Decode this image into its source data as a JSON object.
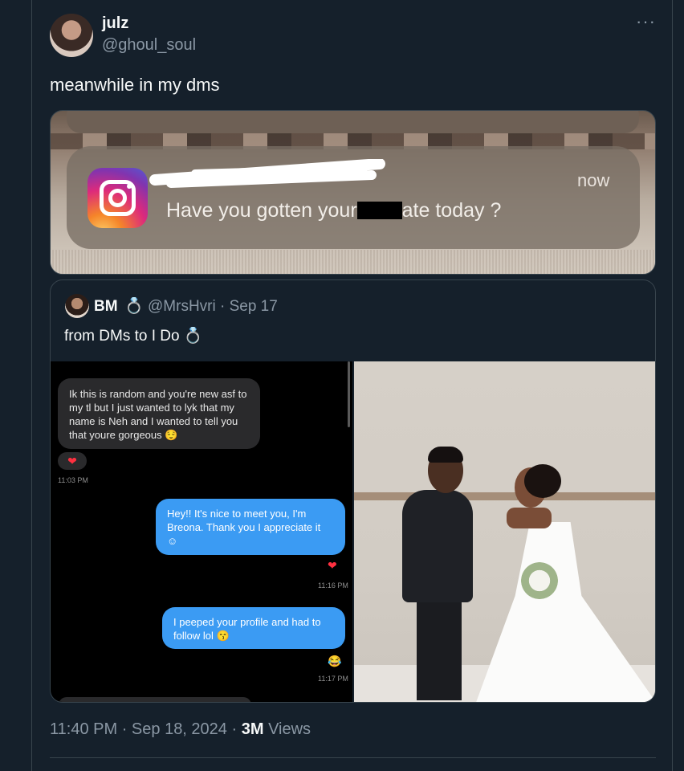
{
  "tweet": {
    "name": "julz",
    "handle": "@ghoul_soul",
    "more": "···",
    "text": "meanwhile in my dms",
    "time": "11:40 PM",
    "sep1": "·",
    "date": "Sep 18, 2024",
    "sep2": "·",
    "views_count": "3M",
    "views_label": " Views"
  },
  "notification": {
    "app_icon": "instagram-icon",
    "time": "now",
    "message_start": "Have you gotten your",
    "message_end": "ate today ?"
  },
  "quote": {
    "name": "BM",
    "ring_emoji": "💍",
    "handle_date": "@MrsHvri · Sep 17",
    "text": "from DMs to I Do",
    "text_emoji": "💍"
  },
  "dm": {
    "incoming_text": "Ik this is random and you're new asf to my tl but I just wanted to lyk that my name is Neh and I wanted to tell you that youre gorgeous 😌",
    "reaction": "❤",
    "time1": "11:03 PM",
    "reply1": "Hey!! It's nice to meet you, I'm Breona. Thank you I appreciate it ☺",
    "time2": "11:16 PM",
    "reply2": "I peeped your profile and had to follow lol 😙",
    "time3": "11:17 PM"
  },
  "colors": {
    "background": "#15202b",
    "bubble_blue": "#3b9bf3",
    "secondary_text": "#8b98a5"
  }
}
